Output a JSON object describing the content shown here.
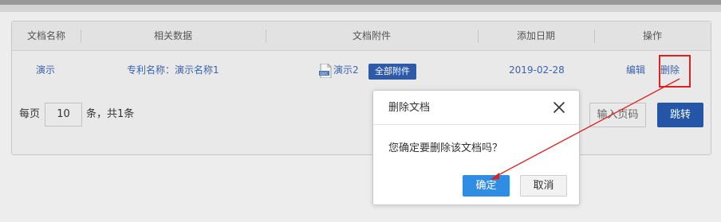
{
  "table": {
    "headers": [
      "文档名称",
      "相关数据",
      "文档附件",
      "添加日期",
      "操作"
    ],
    "rows": [
      {
        "name": "演示",
        "related": "专利名称：演示名称1",
        "attachment": "演示2",
        "attachment_button": "全部附件",
        "date": "2019-02-28",
        "edit": "编辑",
        "delete": "删除"
      }
    ]
  },
  "pager": {
    "per_page_label": "每页",
    "per_page_value": "10",
    "count_label": "条，共1条",
    "page_input_placeholder": "输入页码",
    "jump_label": "跳转"
  },
  "dialog": {
    "title": "删除文档",
    "message": "您确定要删除该文档吗？",
    "ok_label": "确定",
    "cancel_label": "取消"
  },
  "colors": {
    "accent": "#2455a6",
    "primary_button": "#2f8de4",
    "link": "#3a63b0",
    "annotation": "#e02020"
  },
  "icons": {
    "attachment": "doc-file-icon",
    "close": "close-icon"
  }
}
